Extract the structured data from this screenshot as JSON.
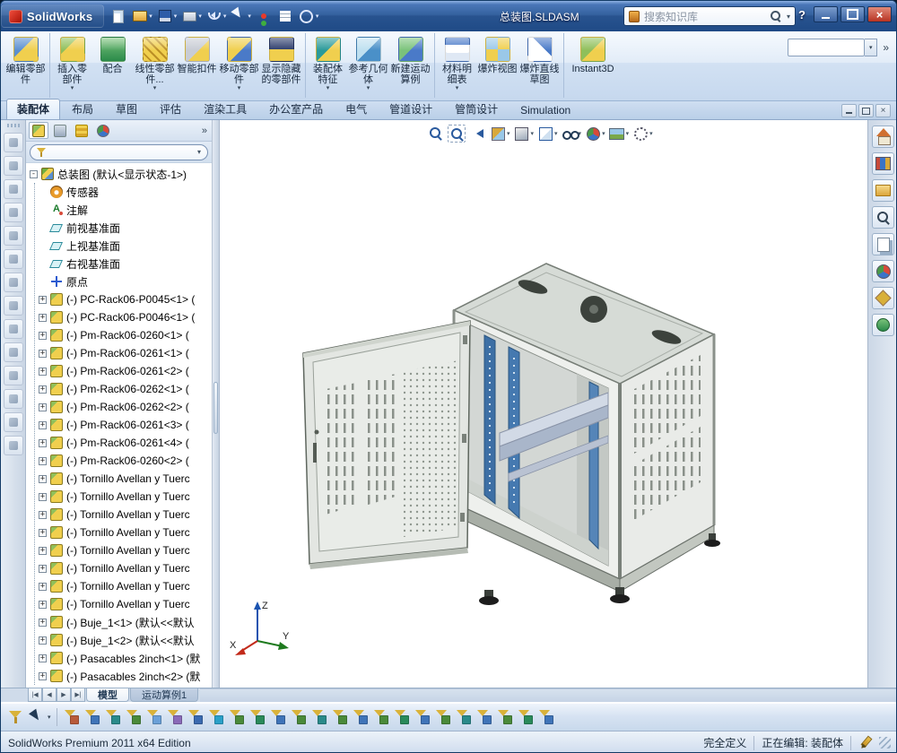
{
  "colors": {
    "titlebar_blue": "#35629f",
    "ribbon_bg": "#d2e1f3",
    "rail_blue": "#4579b0",
    "cabinet_gray": "#e3e6e2",
    "viewport_bg": "#ffffff"
  },
  "titlebar": {
    "brand": "SolidWorks",
    "doc_title": "总装图.SLDASM",
    "search_placeholder": "搜索知识库",
    "help_label": "?",
    "icons": [
      {
        "name": "new-file-icon",
        "kind": "new",
        "caret": ""
      },
      {
        "name": "open-file-icon",
        "kind": "open",
        "caret": "▾"
      },
      {
        "name": "save-icon",
        "kind": "save",
        "caret": "▾"
      },
      {
        "name": "print-icon",
        "kind": "print",
        "caret": "▾"
      },
      {
        "name": "undo-icon",
        "kind": "undo",
        "caret": "▾"
      },
      {
        "name": "select-arrow-icon",
        "kind": "select",
        "caret": "▾"
      },
      {
        "name": "rebuild-icon",
        "kind": "rebuild",
        "caret": ""
      },
      {
        "name": "file-properties-icon",
        "kind": "props",
        "caret": ""
      },
      {
        "name": "options-icon",
        "kind": "options",
        "caret": "▾"
      }
    ]
  },
  "command_manager": {
    "combo_value": "",
    "buttons": [
      {
        "name": "edit-component-button",
        "icon": "edit-component",
        "label": "编辑零部件",
        "caret": "",
        "cls": ""
      },
      {
        "name": "insert-component-button",
        "icon": "insert-component",
        "label": "插入零部件",
        "caret": "▾",
        "cls": "sep-before"
      },
      {
        "name": "mate-button",
        "icon": "mate",
        "label": "配合",
        "caret": "",
        "cls": ""
      },
      {
        "name": "linear-component-pattern-button",
        "icon": "linear-pattern",
        "label": "线性零部件...",
        "caret": "▾",
        "cls": ""
      },
      {
        "name": "smart-fasteners-button",
        "icon": "smart-fasteners",
        "label": "智能扣件",
        "caret": "",
        "cls": ""
      },
      {
        "name": "move-component-button",
        "icon": "move-component",
        "label": "移动零部件",
        "caret": "▾",
        "cls": ""
      },
      {
        "name": "show-hidden-components-button",
        "icon": "show-hidden",
        "label": "显示隐藏的零部件",
        "caret": "",
        "cls": ""
      },
      {
        "name": "assembly-features-button",
        "icon": "assembly-features",
        "label": "装配体特征",
        "caret": "▾",
        "cls": "sep-before"
      },
      {
        "name": "reference-geometry-button",
        "icon": "reference-geometry",
        "label": "参考几何体",
        "caret": "▾",
        "cls": ""
      },
      {
        "name": "new-motion-study-button",
        "icon": "motion-study",
        "label": "新建运动算例",
        "caret": "",
        "cls": ""
      },
      {
        "name": "bill-of-materials-button",
        "icon": "bom",
        "label": "材料明细表",
        "caret": "▾",
        "cls": "sep-before"
      },
      {
        "name": "exploded-view-button",
        "icon": "exploded-view",
        "label": "爆炸视图",
        "caret": "",
        "cls": ""
      },
      {
        "name": "explode-line-sketch-button",
        "icon": "explode-lines",
        "label": "爆炸直线草图",
        "caret": "",
        "cls": ""
      },
      {
        "name": "instant3d-button",
        "icon": "instant3d",
        "label": "Instant3D",
        "caret": "",
        "cls": "wide sep-before"
      }
    ]
  },
  "ribbon_tabs": {
    "items": [
      {
        "name": "tab-assembly",
        "label": "装配体",
        "state": "active"
      },
      {
        "name": "tab-layout",
        "label": "布局",
        "state": ""
      },
      {
        "name": "tab-sketch",
        "label": "草图",
        "state": ""
      },
      {
        "name": "tab-evaluate",
        "label": "评估",
        "state": ""
      },
      {
        "name": "tab-render-tools",
        "label": "渲染工具",
        "state": ""
      },
      {
        "name": "tab-office-products",
        "label": "办公室产品",
        "state": ""
      },
      {
        "name": "tab-electrical",
        "label": "电气",
        "state": ""
      },
      {
        "name": "tab-piping",
        "label": "管道设计",
        "state": ""
      },
      {
        "name": "tab-tubing",
        "label": "管筒设计",
        "state": ""
      },
      {
        "name": "tab-simulation",
        "label": "Simulation",
        "state": ""
      }
    ]
  },
  "feature_tree": {
    "header_tabs": [
      {
        "name": "featuremanager-tab",
        "kind": "fm",
        "state": "active"
      },
      {
        "name": "propertymanager-tab",
        "kind": "pm",
        "state": ""
      },
      {
        "name": "configurationmanager-tab",
        "kind": "cfg",
        "state": ""
      },
      {
        "name": "displaymanager-tab",
        "kind": "disp",
        "state": ""
      }
    ],
    "root": {
      "label": "总装图 (默认<显示状态-1>)"
    },
    "items": [
      {
        "icon": "sensors",
        "exp": "none",
        "label": "传感器"
      },
      {
        "icon": "annotations",
        "exp": "none",
        "label": "注解"
      },
      {
        "icon": "plane",
        "exp": "none",
        "label": "前视基准面"
      },
      {
        "icon": "plane",
        "exp": "none",
        "label": "上视基准面"
      },
      {
        "icon": "plane",
        "exp": "none",
        "label": "右视基准面"
      },
      {
        "icon": "origin",
        "exp": "none",
        "label": "原点"
      },
      {
        "icon": "part",
        "exp": "plus",
        "label": "(-) PC-Rack06-P0045<1> ("
      },
      {
        "icon": "part",
        "exp": "plus",
        "label": "(-) PC-Rack06-P0046<1> ("
      },
      {
        "icon": "part",
        "exp": "plus",
        "label": "(-) Pm-Rack06-0260<1> ("
      },
      {
        "icon": "part",
        "exp": "plus",
        "label": "(-) Pm-Rack06-0261<1> ("
      },
      {
        "icon": "part",
        "exp": "plus",
        "label": "(-) Pm-Rack06-0261<2> ("
      },
      {
        "icon": "part",
        "exp": "plus",
        "label": "(-) Pm-Rack06-0262<1> ("
      },
      {
        "icon": "part",
        "exp": "plus",
        "label": "(-) Pm-Rack06-0262<2> ("
      },
      {
        "icon": "part",
        "exp": "plus",
        "label": "(-) Pm-Rack06-0261<3> ("
      },
      {
        "icon": "part",
        "exp": "plus",
        "label": "(-) Pm-Rack06-0261<4> ("
      },
      {
        "icon": "part",
        "exp": "plus",
        "label": "(-) Pm-Rack06-0260<2> ("
      },
      {
        "icon": "part",
        "exp": "plus",
        "label": "(-) Tornillo Avellan y Tuerc"
      },
      {
        "icon": "part",
        "exp": "plus",
        "label": "(-) Tornillo Avellan y Tuerc"
      },
      {
        "icon": "part",
        "exp": "plus",
        "label": "(-) Tornillo Avellan y Tuerc"
      },
      {
        "icon": "part",
        "exp": "plus",
        "label": "(-) Tornillo Avellan y Tuerc"
      },
      {
        "icon": "part",
        "exp": "plus",
        "label": "(-) Tornillo Avellan y Tuerc"
      },
      {
        "icon": "part",
        "exp": "plus",
        "label": "(-) Tornillo Avellan y Tuerc"
      },
      {
        "icon": "part",
        "exp": "plus",
        "label": "(-) Tornillo Avellan y Tuerc"
      },
      {
        "icon": "part",
        "exp": "plus",
        "label": "(-) Tornillo Avellan y Tuerc"
      },
      {
        "icon": "part",
        "exp": "plus",
        "label": "(-) Buje_1<1> (默认<<默认"
      },
      {
        "icon": "part",
        "exp": "plus",
        "label": "(-) Buje_1<2> (默认<<默认"
      },
      {
        "icon": "part",
        "exp": "plus",
        "label": "(-) Pasacables 2inch<1> (默"
      },
      {
        "icon": "part",
        "exp": "plus",
        "label": "(-) Pasacables 2inch<2> (默"
      }
    ]
  },
  "left_toolbar": {
    "icons": [
      {
        "name": "select-tool-icon"
      },
      {
        "name": "zoom-fit-icon"
      },
      {
        "name": "zoom-area-icon"
      },
      {
        "name": "previous-view-icon"
      },
      {
        "name": "section-view-icon"
      },
      {
        "name": "view-orientation-icon"
      },
      {
        "name": "display-style-icon"
      },
      {
        "name": "hide-show-icon"
      },
      {
        "name": "edit-appearance-icon"
      },
      {
        "name": "apply-scene-icon"
      },
      {
        "name": "annotations-tool-icon"
      },
      {
        "name": "measure-tool-icon"
      },
      {
        "name": "mass-properties-icon"
      },
      {
        "name": "options-tool-icon"
      }
    ]
  },
  "viewport": {
    "headsup": [
      {
        "name": "zoom-fit-icon",
        "kind": "mag",
        "caret": ""
      },
      {
        "name": "zoom-area-icon",
        "kind": "magarea",
        "caret": ""
      },
      {
        "name": "previous-view-icon",
        "kind": "prev",
        "caret": ""
      },
      {
        "name": "section-view-icon",
        "kind": "section",
        "caret": "▾"
      },
      {
        "name": "view-orientation-icon",
        "kind": "cube",
        "caret": "▾"
      },
      {
        "name": "display-style-icon",
        "kind": "display",
        "caret": "▾"
      },
      {
        "name": "hide-show-items-icon",
        "kind": "glasses",
        "caret": "▾"
      },
      {
        "name": "edit-appearance-icon",
        "kind": "ball",
        "caret": "▾"
      },
      {
        "name": "apply-scene-icon",
        "kind": "scene",
        "caret": "▾"
      },
      {
        "name": "view-settings-icon",
        "kind": "settings",
        "caret": "▾"
      }
    ],
    "triad": {
      "x_label": "X",
      "y_label": "Y",
      "z_label": "Z"
    }
  },
  "right_pane": {
    "icons": [
      {
        "name": "solidworks-resources-icon",
        "kind": "home"
      },
      {
        "name": "design-library-icon",
        "kind": "library"
      },
      {
        "name": "file-explorer-icon",
        "kind": "folder"
      },
      {
        "name": "search-icon",
        "kind": "search"
      },
      {
        "name": "view-palette-icon",
        "kind": "palette"
      },
      {
        "name": "appearances-scenes-icon",
        "kind": "ball"
      },
      {
        "name": "custom-properties-icon",
        "kind": "props"
      },
      {
        "name": "document-recovery-icon",
        "kind": "recovery"
      }
    ]
  },
  "model_tabs": {
    "items": [
      {
        "name": "tab-model",
        "label": "模型",
        "state": "active"
      },
      {
        "name": "tab-motion-study-1",
        "label": "运动算例1",
        "state": ""
      }
    ]
  },
  "selection_filter_toolbar": {
    "icons": [
      {
        "name": "clear-all-filters-icon",
        "style": "--ac:#b85a3a"
      },
      {
        "name": "filter-vertices-icon",
        "style": "--ac:#3f74b8"
      },
      {
        "name": "filter-edges-icon",
        "style": "--ac:#2a8a8a"
      },
      {
        "name": "filter-faces-icon",
        "style": "--ac:#4a8a3a"
      },
      {
        "name": "filter-surface-bodies-icon",
        "style": "--ac:#6aa0d8"
      },
      {
        "name": "filter-solid-bodies-icon",
        "style": "--ac:#8a6ab8"
      },
      {
        "name": "filter-axes-icon",
        "style": "--ac:#3a6ab0"
      },
      {
        "name": "filter-planes-icon",
        "style": "--ac:#2aa0c8"
      },
      {
        "name": "filter-sketch-points-icon",
        "style": "--ac:#4a8a3a"
      },
      {
        "name": "filter-sketch-segments-icon",
        "style": "--ac:#2a8a5a"
      },
      {
        "name": "filter-midpoints-icon",
        "style": "--ac:#3f74b8"
      },
      {
        "name": "filter-center-marks-icon",
        "style": "--ac:#4a8a3a"
      },
      {
        "name": "filter-centerlines-icon",
        "style": "--ac:#2a8a8a"
      },
      {
        "name": "filter-dimensions-icon",
        "style": "--ac:#4a8a3a"
      },
      {
        "name": "filter-surface-finish-icon",
        "style": "--ac:#3f74b8"
      },
      {
        "name": "filter-geometric-tolerances-icon",
        "style": "--ac:#4a8a3a"
      },
      {
        "name": "filter-notes-icon",
        "style": "--ac:#2a8a5a"
      },
      {
        "name": "filter-datums-icon",
        "style": "--ac:#3f74b8"
      },
      {
        "name": "filter-weld-symbols-icon",
        "style": "--ac:#4a8a3a"
      },
      {
        "name": "filter-datum-targets-icon",
        "style": "--ac:#2a8a8a"
      },
      {
        "name": "filter-blocks-icon",
        "style": "--ac:#3f74b8"
      },
      {
        "name": "filter-cosmetic-threads-icon",
        "style": "--ac:#4a8a3a"
      },
      {
        "name": "filter-connection-points-icon",
        "style": "--ac:#2a8a5a"
      },
      {
        "name": "filter-routing-points-icon",
        "style": "--ac:#3f74b8"
      }
    ]
  },
  "status_bar": {
    "edition": "SolidWorks Premium 2011 x64 Edition",
    "definition": "完全定义",
    "editing": "正在编辑: 装配体"
  }
}
